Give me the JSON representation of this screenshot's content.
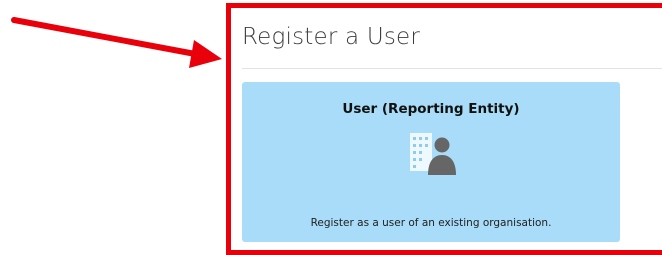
{
  "page": {
    "title": "Register a User"
  },
  "card": {
    "heading": "User (Reporting Entity)",
    "description": "Register as a user of an existing organisation.",
    "icon": "user-building-icon",
    "background_color": "#a8dcf8"
  },
  "annotation": {
    "arrow_icon": "red-arrow-icon",
    "highlight_color": "#e8000b"
  }
}
